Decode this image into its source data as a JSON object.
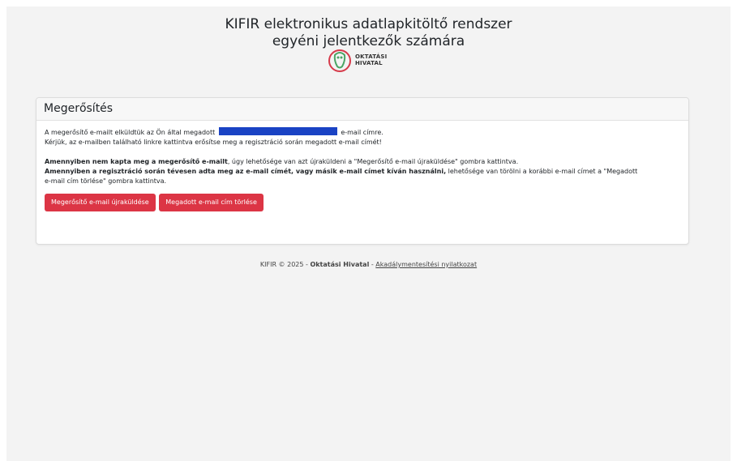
{
  "header": {
    "title_line1": "KIFIR elektronikus adatlapkitöltő rendszer",
    "title_line2": "egyéni jelentkezők számára",
    "logo_text_line1": "OKTATÁSI",
    "logo_text_line2": "HIVATAL"
  },
  "card": {
    "title": "Megerősítés",
    "p1_before": "A megerősítő e-mailt elküldtük az Ön által megadott",
    "p1_after": "e-mail címre.",
    "p2": "Kérjük, az e-mailben található linkre kattintva erősítse meg a regisztráció során megadott e-mail címét!",
    "p3_bold": "Amennyiben nem kapta meg a megerősítő e-mailt",
    "p3_rest": ", úgy lehetősége van azt újraküldeni a \"Megerősítő e-mail újraküldése\" gombra kattintva.",
    "p4_bold": "Amennyiben a regisztráció során tévesen adta meg az e-mail címét, vagy másik e-mail címet kíván használni,",
    "p4_rest": " lehetősége van törölni a korábbi e-mail címet a \"Megadott",
    "p4_line2": "e-mail cím törlése\" gombra kattintva.",
    "resend_button": "Megerősítő e-mail újraküldése",
    "delete_button": "Megadott e-mail cím törlése"
  },
  "footer": {
    "copyright": "KIFIR © 2025 - ",
    "org": "Oktatási Hivatal",
    "separator": " - ",
    "link": "Akadálymentesítési nyilatkozat"
  },
  "colors": {
    "button": "#dc3545",
    "redaction": "#1a43c4",
    "background": "#f3f3f3"
  }
}
